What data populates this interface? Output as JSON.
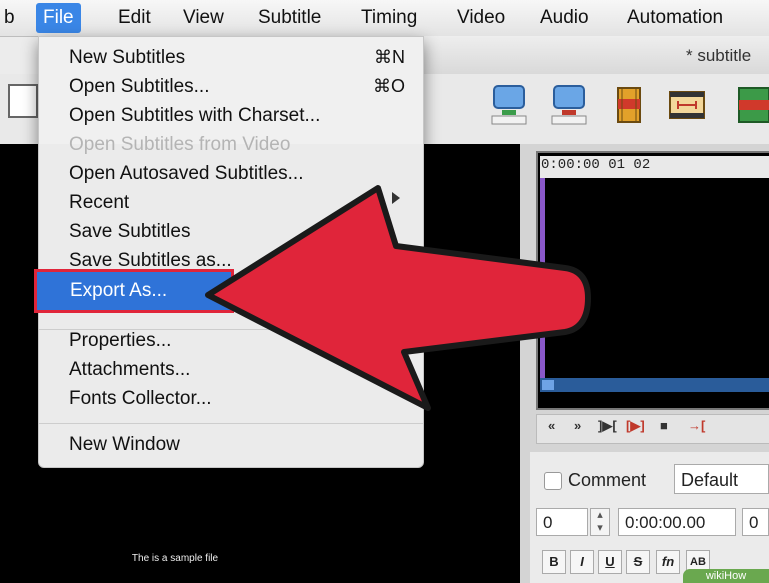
{
  "menubar": {
    "items": [
      "b",
      "File",
      "Edit",
      "View",
      "Subtitle",
      "Timing",
      "Video",
      "Audio",
      "Automation"
    ]
  },
  "window": {
    "title": "* subtitle"
  },
  "file_menu": {
    "items": [
      {
        "label": "New Subtitles",
        "shortcut": "⌘N"
      },
      {
        "label": "Open Subtitles...",
        "shortcut": "⌘O"
      },
      {
        "label": "Open Subtitles with Charset..."
      },
      {
        "label": "Open Subtitles from Video",
        "disabled": true
      },
      {
        "label": "Open Autosaved Subtitles..."
      },
      {
        "label": "Recent"
      },
      {
        "label": "Save Subtitles"
      },
      {
        "label": "Save Subtitles as..."
      },
      {
        "label": "Export As..."
      },
      {
        "label": "Properties..."
      },
      {
        "label": "Attachments..."
      },
      {
        "label": "Fonts Collector..."
      },
      {
        "label": "New Window"
      }
    ]
  },
  "audio": {
    "ruler": "0:00:00 01        02"
  },
  "playback": {
    "buttons": [
      "«",
      "»",
      "]▶[",
      "[▶]",
      "■",
      "→["
    ]
  },
  "edit": {
    "comment_label": "Comment",
    "style": "Default",
    "layer": "0",
    "start_time": "0:00:00.00",
    "end_time": "0",
    "format_buttons": [
      "B",
      "I",
      "U",
      "S",
      "fn",
      "AB"
    ]
  },
  "video": {
    "caption": "The is a sample file"
  },
  "watermark": "wikiHow",
  "colors": {
    "menu_highlight": "#2f73d8",
    "arrow": "#e0253a",
    "active_menu": "#3a86e6"
  }
}
